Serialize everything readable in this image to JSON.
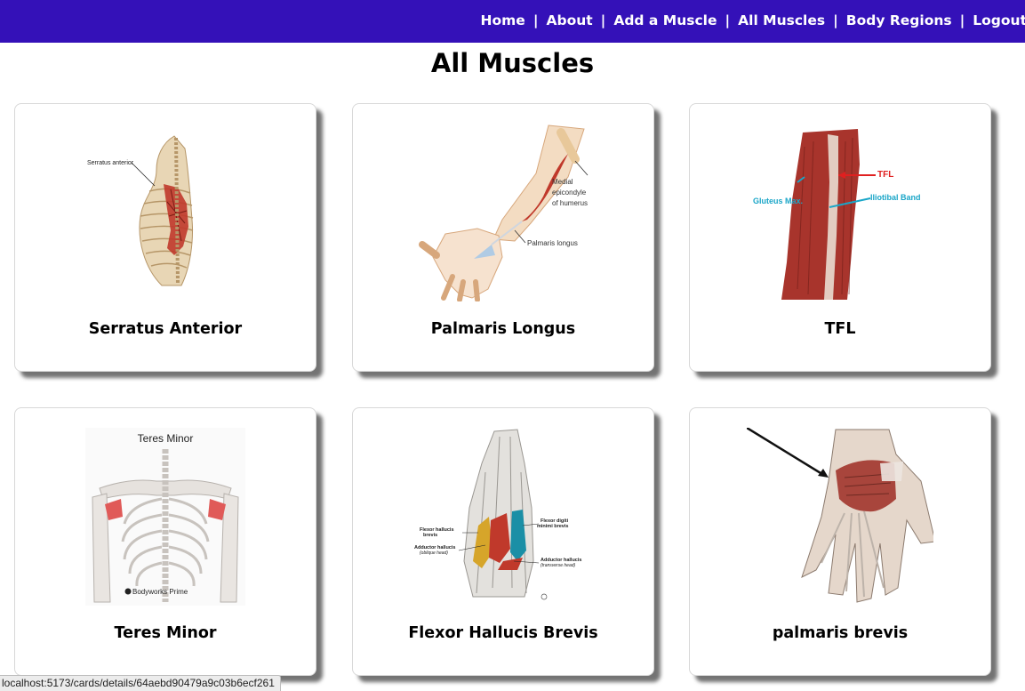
{
  "nav": {
    "home": "Home",
    "about": "About",
    "add": "Add a Muscle",
    "all": "All Muscles",
    "regions": "Body Regions",
    "logout": "Logout",
    "separator": "|"
  },
  "page": {
    "title": "All Muscles"
  },
  "cards": [
    {
      "name": "Serratus Anterior",
      "image_labels": [
        "Serratus anterior"
      ]
    },
    {
      "name": "Palmaris Longus",
      "image_labels": [
        "Medial",
        "epicondyle",
        "of humerus",
        "Palmaris longus"
      ]
    },
    {
      "name": "TFL",
      "image_labels": [
        "TFL",
        "Gluteus Max.",
        "Iliotibal Band"
      ]
    },
    {
      "name": "Teres Minor",
      "image_labels": [
        "Teres Minor",
        "Bodyworks Prime"
      ]
    },
    {
      "name": "Flexor Hallucis Brevis",
      "image_labels": [
        "Flexor hallucis",
        "brevis",
        "Adductor hallucis",
        "(oblique head)",
        "Flexor digiti",
        "minimi brevis",
        "Adductor hallucis",
        "(transverse head)"
      ]
    },
    {
      "name": "palmaris brevis",
      "image_labels": []
    }
  ],
  "status_bar": {
    "url": "localhost:5173/cards/details/64aebd90479a9c03b6ecf261"
  },
  "colors": {
    "navbar": "#3411b8",
    "muscle_red": "#c0392b",
    "label_red": "#e02020",
    "label_cyan": "#1aa6c8",
    "bone": "#e8d6b5"
  }
}
